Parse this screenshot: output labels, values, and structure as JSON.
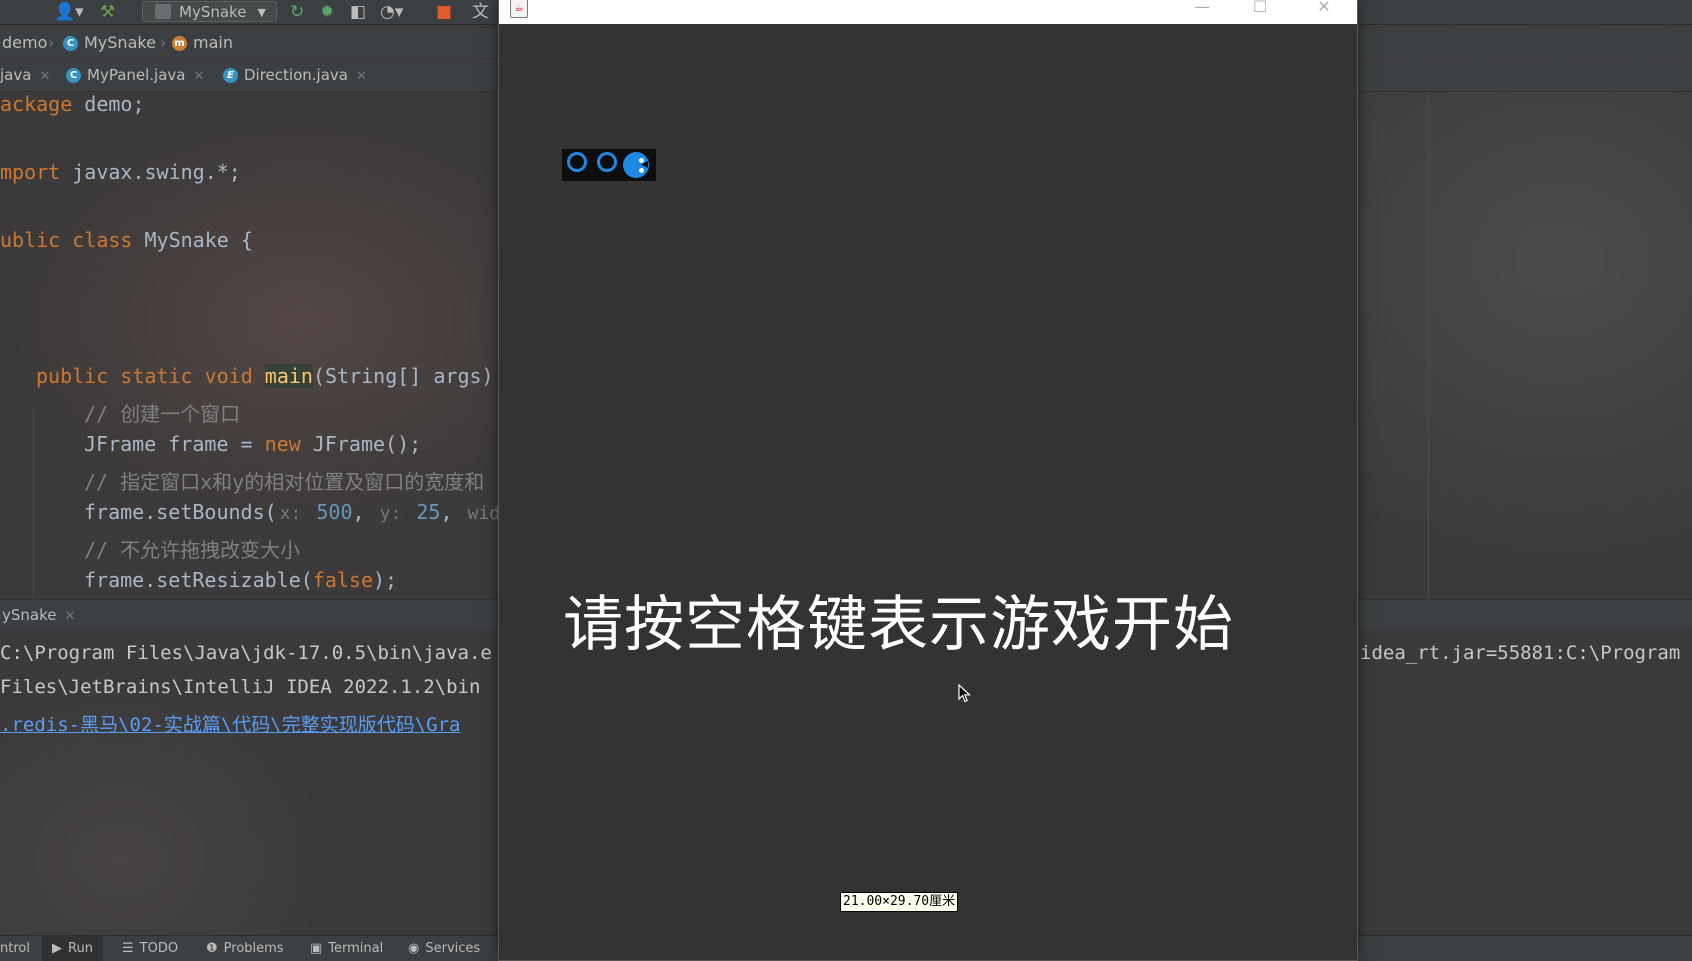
{
  "ide": {
    "toolbar": {
      "run_config": "MySnake"
    },
    "breadcrumb": {
      "items": [
        "demo",
        "MySnake",
        "main"
      ]
    },
    "tabs": [
      {
        "label": "java"
      },
      {
        "label": "MyPanel.java"
      },
      {
        "label": "Direction.java"
      }
    ],
    "code": {
      "package_kw": "ackage",
      "package_name": " demo;",
      "import_kw": "mport",
      "import_name": " javax.swing.*;",
      "class_kw": "ublic class",
      "class_name": " MySnake {",
      "main_kw": "public static void",
      "main_fn": "main",
      "main_args": "(String[] args)",
      "comment1": "// 创建一个窗口",
      "frame_type": "JFrame frame = ",
      "frame_new": "new",
      "frame_ctor": " JFrame();",
      "comment2": "// 指定窗口x和y的相对位置及窗口的宽度和",
      "setbounds": "frame.setBounds(",
      "hint_x": "x:",
      "val_x": "500",
      "hint_y": "y:",
      "val_y": "25",
      "hint_w": "widt",
      "comment3": "// 不允许拖拽改变大小",
      "setresizable": "frame.setResizable(",
      "false_kw": "false",
      "setresizable_end": ");"
    },
    "run_panel": {
      "tab_label": "ySnake"
    },
    "console": {
      "line1": "C:\\Program Files\\Java\\jdk-17.0.5\\bin\\java.e",
      "line2": "Files\\JetBrains\\IntelliJ IDEA 2022.1.2\\bin",
      "line3": ".redis-黑马\\02-实战篇\\代码\\完整实现版代码\\Gra",
      "right_line1": "idea_rt.jar=55881:C:\\Program"
    },
    "statusbar": {
      "items": [
        "ntrol",
        "Run",
        "TODO",
        "Problems",
        "Terminal",
        "Services"
      ]
    }
  },
  "game_window": {
    "minimize": "—",
    "maximize": "☐",
    "close": "✕",
    "start_message": "请按空格键表示游戏开始",
    "size_tooltip": "21.00×29.70厘米"
  },
  "colors": {
    "snake": "#1e88e5",
    "game_background": "#333333",
    "keyword": "#cc7832",
    "comment": "#808080",
    "number": "#6897bb",
    "method": "#ffc66d"
  }
}
